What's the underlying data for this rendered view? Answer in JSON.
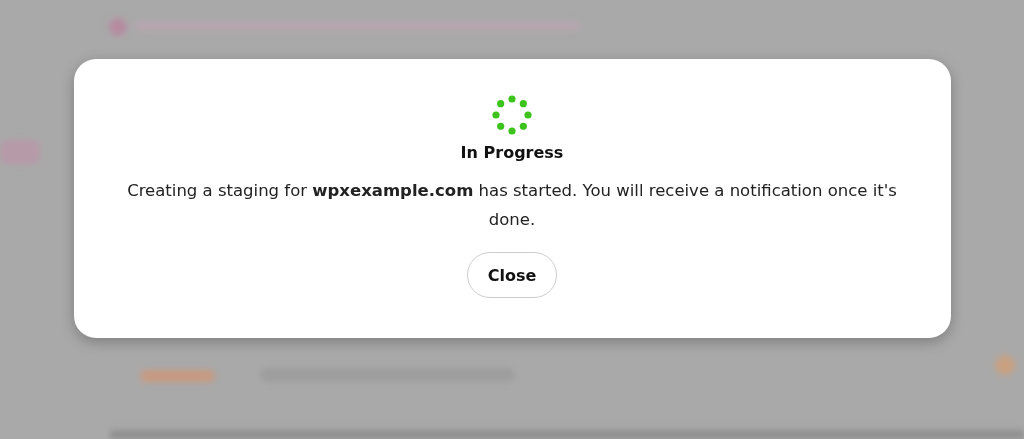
{
  "dialog": {
    "title": "In Progress",
    "message": "Creating a staging for **wpxexample.com** has started. You will receive a notification once it's done.",
    "buttons": [
      {
        "label": "Close"
      }
    ]
  }
}
